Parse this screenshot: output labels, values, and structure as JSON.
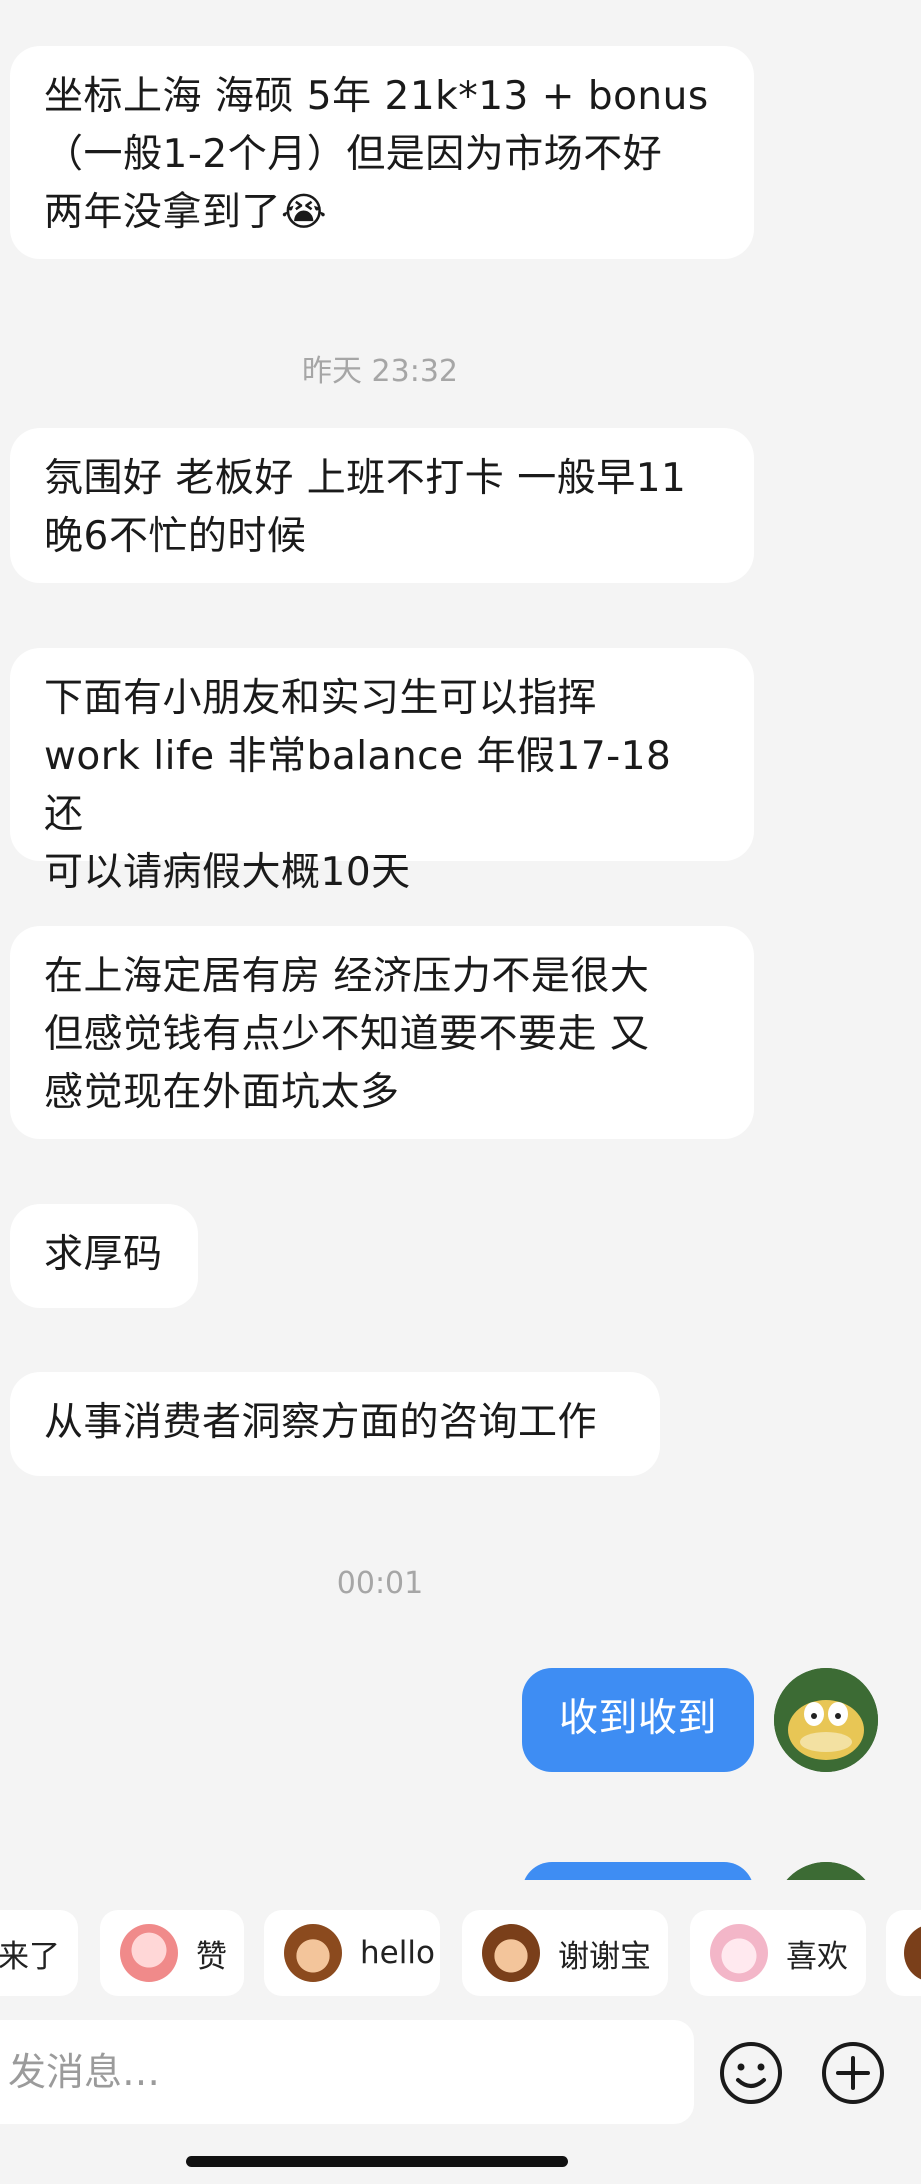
{
  "messages": [
    {
      "dir": "in",
      "text": "坐标上海 海硕 5年 21k*13 + bonus\n（一般1-2个月）但是因为市场不好\n两年没拿到了😭"
    },
    {
      "type": "time",
      "text": "昨天 23:32"
    },
    {
      "dir": "in",
      "text": "氛围好 老板好 上班不打卡 一般早11\n晚6不忙的时候"
    },
    {
      "dir": "in",
      "text": "下面有小朋友和实习生可以指挥\nwork life 非常balance 年假17-18 还\n可以请病假大概10天"
    },
    {
      "dir": "in",
      "text": "在上海定居有房 经济压力不是很大\n但感觉钱有点少不知道要不要走 又\n感觉现在外面坑太多"
    },
    {
      "dir": "in",
      "text": "求厚码"
    },
    {
      "dir": "in",
      "text": "从事消费者洞察方面的咨询工作"
    },
    {
      "type": "time",
      "text": "00:01"
    },
    {
      "dir": "out",
      "text": "收到收到"
    }
  ],
  "quick_replies": [
    {
      "label": "来了",
      "icon": "sticker-icon",
      "color": "#f1a14a"
    },
    {
      "label": "赞",
      "icon": "thumbs-up-sticker-icon",
      "color": "#f08a8a"
    },
    {
      "label": "hello",
      "icon": "monkey-wave-sticker-icon",
      "color": "#b5651d"
    },
    {
      "label": "谢谢宝",
      "icon": "monkey-flower-sticker-icon",
      "color": "#a0522d"
    },
    {
      "label": "喜欢",
      "icon": "sheep-sticker-icon",
      "color": "#f3b6c8"
    }
  ],
  "composer": {
    "placeholder": "发消息…"
  },
  "icons": {
    "emoji_button": "smiley-icon",
    "plus_button": "plus-circle-icon"
  },
  "colors": {
    "background": "#f4f4f4",
    "incoming_bubble": "#ffffff",
    "outgoing_bubble": "#3e8df3",
    "timestamp": "#a6a6a6"
  }
}
